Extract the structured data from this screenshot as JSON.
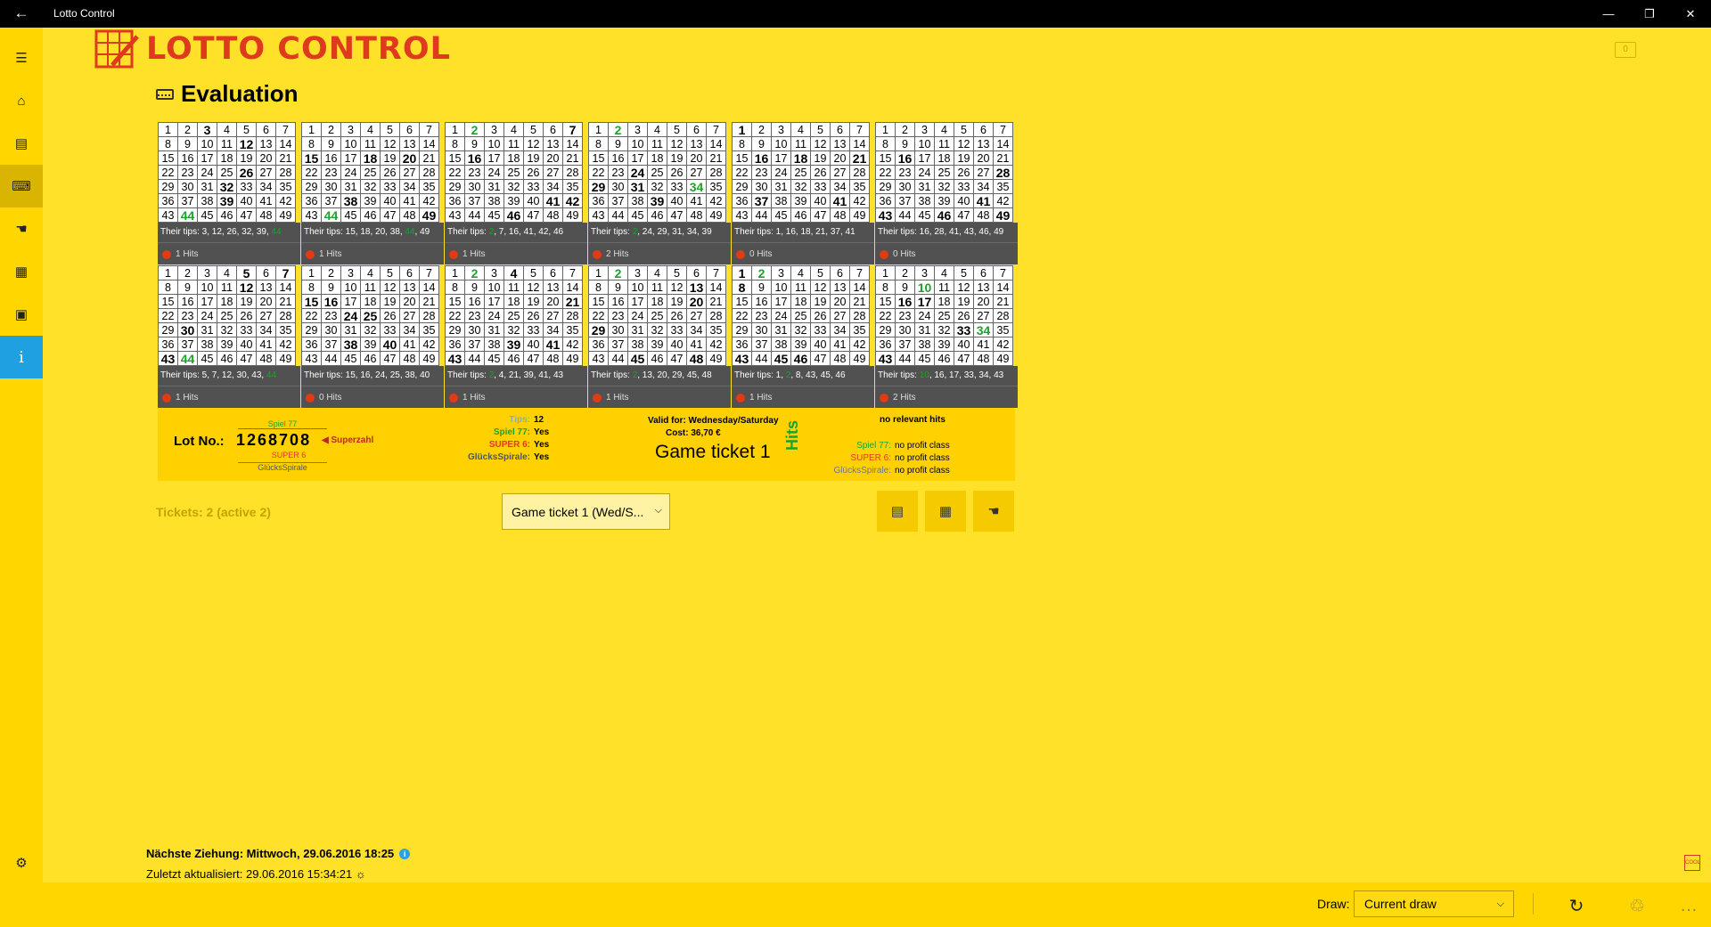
{
  "window": {
    "title": "Lotto Control"
  },
  "app": {
    "logo_text": "LOTTO CONTROL",
    "message_count": "0"
  },
  "page": {
    "title": "Evaluation"
  },
  "tickets": [
    {
      "bold": [
        3,
        12,
        26,
        32,
        39
      ],
      "green": [
        44
      ],
      "tips_prefix": "Their tips: 3, 12, 26, 32, 39, ",
      "tips_green": "44",
      "tips_suffix": "",
      "hits": "1 Hits"
    },
    {
      "bold": [
        15,
        18,
        20,
        38,
        49
      ],
      "green": [
        44
      ],
      "tips_prefix": "Their tips: 15, 18, 20, 38, ",
      "tips_green": "44",
      "tips_suffix": ", 49",
      "hits": "1 Hits"
    },
    {
      "bold": [
        7,
        16,
        41,
        42,
        46
      ],
      "green": [
        2
      ],
      "tips_prefix": "Their tips: ",
      "tips_green": "2",
      "tips_suffix": ", 7, 16, 41, 42, 46",
      "hits": "1 Hits"
    },
    {
      "bold": [
        24,
        29,
        31,
        39
      ],
      "green": [
        2,
        34
      ],
      "tips_prefix": "Their tips: ",
      "tips_green": "2",
      "tips_suffix": ", 24, 29, 31, 34, 39",
      "hits": "2 Hits"
    },
    {
      "bold": [
        1,
        16,
        18,
        21,
        37,
        41
      ],
      "green": [],
      "tips_prefix": "Their tips: 1, 16, 18, 21, 37, 41",
      "tips_green": "",
      "tips_suffix": "",
      "hits": "0 Hits"
    },
    {
      "bold": [
        16,
        28,
        41,
        43,
        46,
        49
      ],
      "green": [],
      "tips_prefix": "Their tips: 16, 28, 41, 43, 46, 49",
      "tips_green": "",
      "tips_suffix": "",
      "hits": "0 Hits"
    },
    {
      "bold": [
        5,
        7,
        12,
        30,
        43
      ],
      "green": [
        44
      ],
      "tips_prefix": "Their tips: 5, 7, 12, 30, 43, ",
      "tips_green": "44",
      "tips_suffix": "",
      "hits": "1 Hits"
    },
    {
      "bold": [
        15,
        16,
        24,
        25,
        38,
        40
      ],
      "green": [],
      "tips_prefix": "Their tips: 15, 16, 24, 25, 38, 40",
      "tips_green": "",
      "tips_suffix": "",
      "hits": "0 Hits"
    },
    {
      "bold": [
        4,
        21,
        39,
        41,
        43
      ],
      "green": [
        2
      ],
      "tips_prefix": "Their tips: ",
      "tips_green": "2",
      "tips_suffix": ", 4, 21, 39, 41, 43",
      "hits": "1 Hits"
    },
    {
      "bold": [
        13,
        20,
        29,
        45,
        48
      ],
      "green": [
        2
      ],
      "tips_prefix": "Their tips: ",
      "tips_green": "2",
      "tips_suffix": ", 13, 20, 29, 45, 48",
      "hits": "1 Hits"
    },
    {
      "bold": [
        1,
        8,
        43,
        45,
        46
      ],
      "green": [
        2
      ],
      "tips_prefix": "Their tips: 1, ",
      "tips_green": "2",
      "tips_suffix": ", 8, 43, 45, 46",
      "hits": "1 Hits"
    },
    {
      "bold": [
        16,
        17,
        33,
        43
      ],
      "green": [
        10,
        34
      ],
      "tips_prefix": "Their tips: ",
      "tips_green": "10",
      "tips_suffix": ", 16, 17, 33, 34, 43",
      "hits": "2 Hits"
    }
  ],
  "info": {
    "lot_label": "Lot No.:",
    "lot_number": "1268708",
    "superzahl_label": "◀ Superzahl",
    "spiel77_label": "Spiel 77",
    "super6_label": "SUPER 6",
    "gluecksspirale_label": "GlücksSpirale",
    "tips_label": "Tips:",
    "tips_value": "12",
    "spiel77_row_label": "Spiel 77:",
    "spiel77_value": "Yes",
    "super6_row_label": "SUPER 6:",
    "super6_value": "Yes",
    "gs_row_label": "GlücksSpirale:",
    "gs_value": "Yes",
    "valid_for": "Valid for: Wednesday/Saturday",
    "cost": "Cost: 36,70 €",
    "ticket_name": "Game ticket 1",
    "hits_vertical": "Hits",
    "no_relevant": "no relevant hits",
    "pc_spiel77_label": "Spiel 77:",
    "pc_spiel77_value": "no profit class",
    "pc_super6_label": "SUPER 6:",
    "pc_super6_value": "no profit class",
    "pc_gs_label": "GlücksSpirale:",
    "pc_gs_value": "no profit class"
  },
  "controls": {
    "tickets_count": "Tickets: 2 (active 2)",
    "ticket_select": "Game ticket 1  (Wed/S...",
    "buttons": [
      "ticket-icon",
      "calculator-icon",
      "hand-pointer-icon"
    ]
  },
  "footer": {
    "next_draw": "Nächste Ziehung: Mittwoch, 29.06.2016 18:25",
    "last_updated": "Zuletzt aktualisiert: 29.06.2016 15:34:21",
    "draw_label": "Draw:",
    "draw_value": "Current draw",
    "cool_badge": "COOL"
  },
  "colors": {
    "background": "#FFE12A",
    "accent_green": "#1BA32A",
    "accent_red": "#E03A1E",
    "info_blue": "#1FA0E0"
  }
}
